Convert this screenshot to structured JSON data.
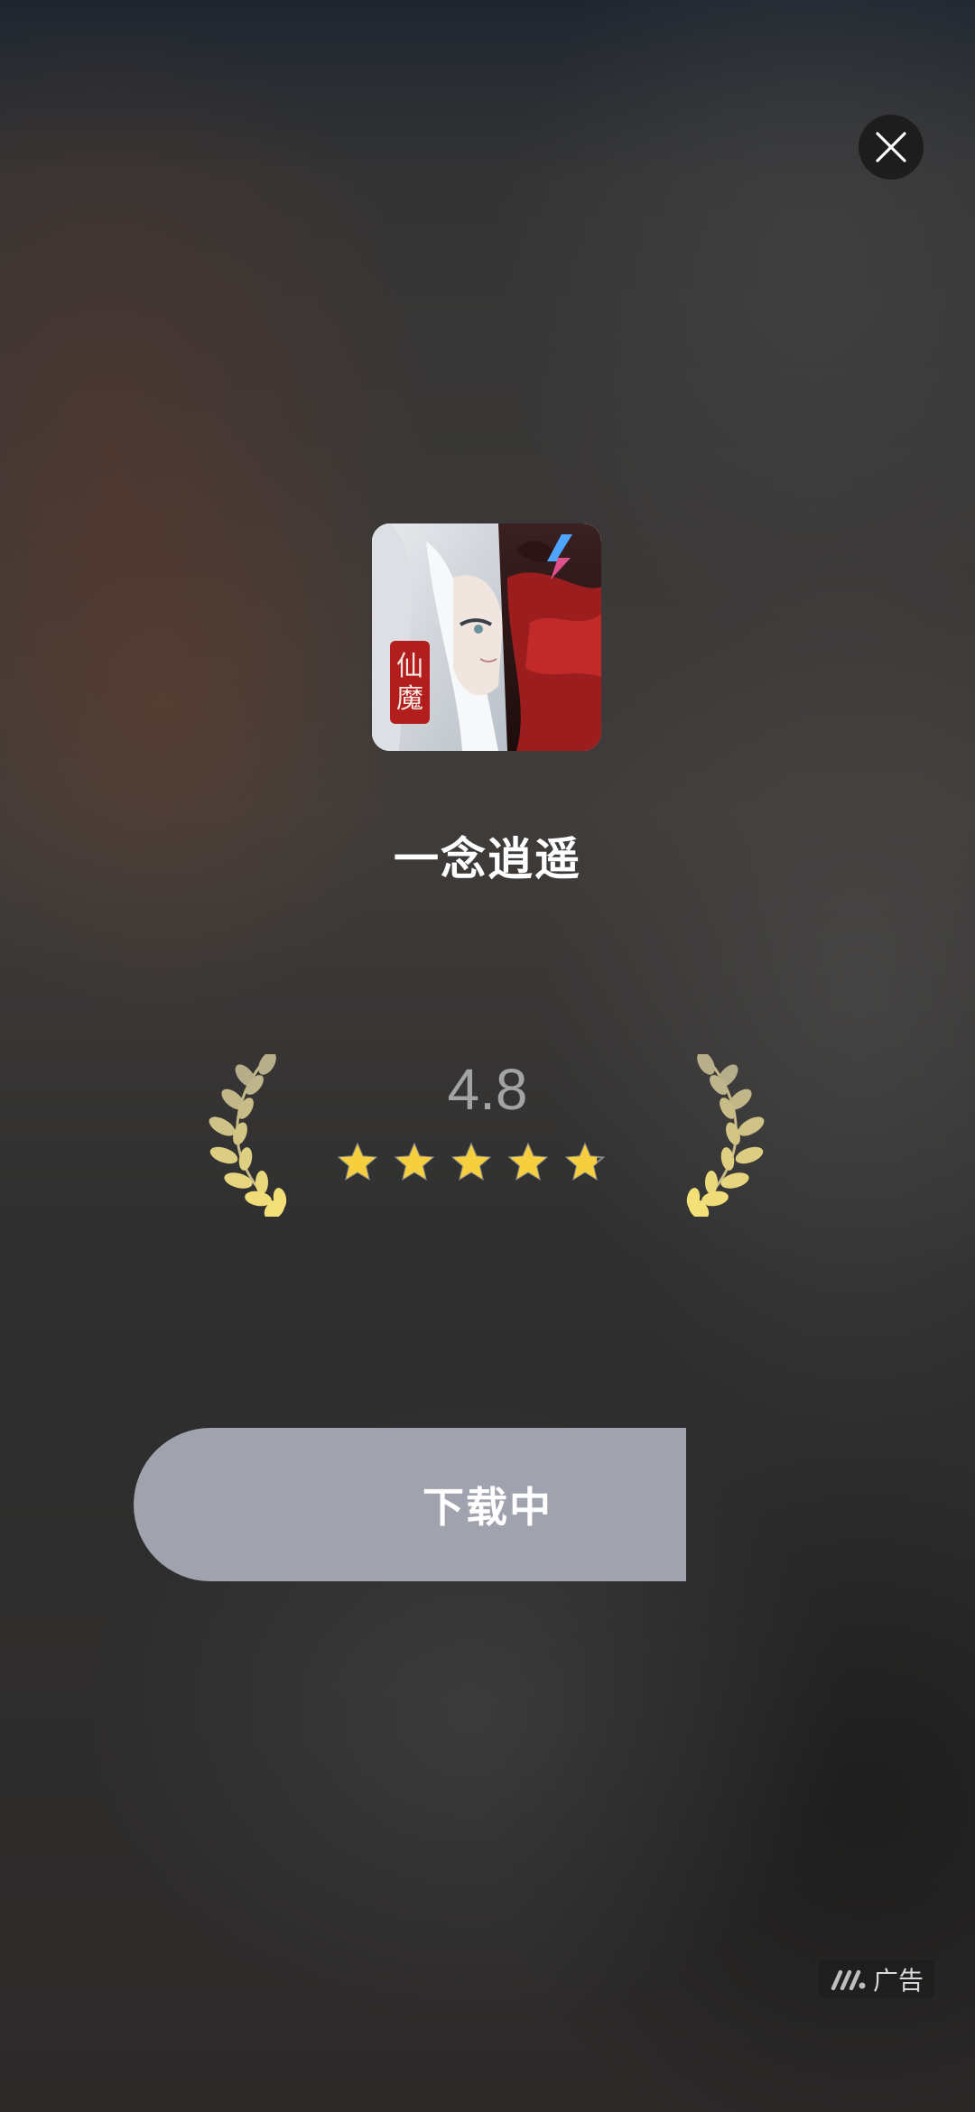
{
  "app": {
    "name": "一念逍遥",
    "icon_text": "仙魔",
    "icon": "app-icon"
  },
  "rating": {
    "value": "4.8",
    "score": 4.8,
    "max": 5
  },
  "download": {
    "label": "下载中"
  },
  "ad": {
    "label": "广告",
    "icon": "ad-logo-icon"
  },
  "close": {
    "icon": "close-icon"
  },
  "colors": {
    "button": "#a0a2ad",
    "star": "#f6cf3e",
    "rating_text": "#a3a3a3"
  }
}
